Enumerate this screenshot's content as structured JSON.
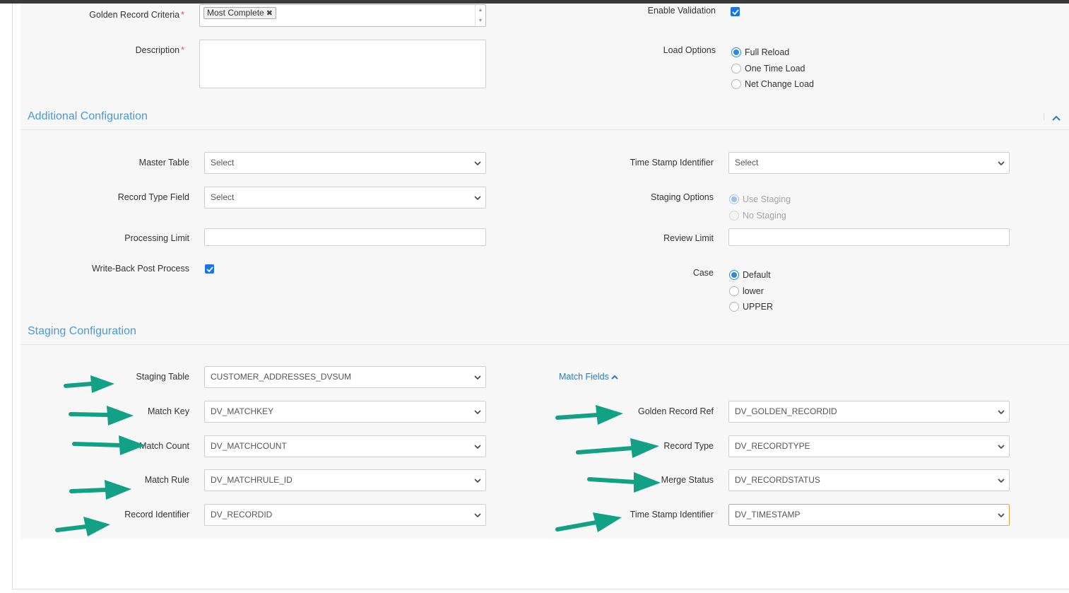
{
  "general": {
    "golden_record_criteria_label": "Golden Record Criteria",
    "golden_record_criteria_tag": "Most Complete",
    "description_label": "Description",
    "required_mark": "*",
    "enable_validation_label": "Enable Validation",
    "enable_validation_checked": true,
    "load_options_label": "Load Options",
    "load_options": [
      "Full Reload",
      "One Time Load",
      "Net Change Load"
    ],
    "load_options_selected": "Full Reload"
  },
  "additional": {
    "title": "Additional Configuration",
    "master_table_label": "Master Table",
    "master_table_value": "Select",
    "record_type_field_label": "Record Type Field",
    "record_type_field_value": "Select",
    "processing_limit_label": "Processing Limit",
    "write_back_label": "Write-Back Post Process",
    "write_back_checked": true,
    "time_stamp_identifier_label": "Time Stamp Identifier",
    "time_stamp_identifier_value": "Select",
    "staging_options_label": "Staging Options",
    "staging_options": [
      "Use Staging",
      "No Staging"
    ],
    "staging_options_selected": "Use Staging",
    "review_limit_label": "Review Limit",
    "case_label": "Case",
    "case_options": [
      "Default",
      "lower",
      "UPPER"
    ],
    "case_selected": "Default"
  },
  "staging": {
    "title": "Staging Configuration",
    "match_fields_link": "Match Fields",
    "staging_table_label": "Staging Table",
    "staging_table_value": "CUSTOMER_ADDRESSES_DVSUM",
    "match_key_label": "Match Key",
    "match_key_value": "DV_MATCHKEY",
    "match_count_label": "Match Count",
    "match_count_value": "DV_MATCHCOUNT",
    "match_rule_label": "Match Rule",
    "match_rule_value": "DV_MATCHRULE_ID",
    "record_identifier_label": "Record Identifier",
    "record_identifier_value": "DV_RECORDID",
    "golden_record_ref_label": "Golden Record Ref",
    "golden_record_ref_value": "DV_GOLDEN_RECORDID",
    "record_type_label": "Record Type",
    "record_type_value": "DV_RECORDTYPE",
    "merge_status_label": "Merge Status",
    "merge_status_value": "DV_RECORDSTATUS",
    "time_stamp_identifier_label": "Time Stamp Identifier",
    "time_stamp_identifier_value": "DV_TIMESTAMP"
  },
  "colors": {
    "accent": "#4a9ad4",
    "arrow": "#12a184",
    "checkbox": "#1a73e8",
    "focus_border": "#e8a33d"
  }
}
